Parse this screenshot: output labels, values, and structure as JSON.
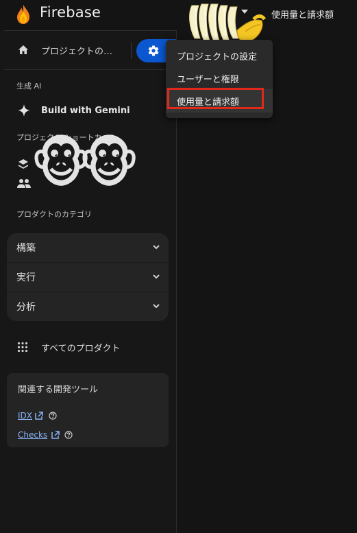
{
  "header": {
    "brand": "Firebase",
    "right_label": "使用量と請求額",
    "logo_icon": "firebase-flame-icon"
  },
  "sidebar": {
    "project_name": "プロジェクトの…",
    "genai_section": "生成 AI",
    "gemini_label": "Build with Gemini",
    "shortcuts_section": "プロジェクト ショートカット",
    "categories_section": "プロダクトのカテゴリ",
    "categories": [
      {
        "label": "構築"
      },
      {
        "label": "実行"
      },
      {
        "label": "分析"
      }
    ],
    "all_products": "すべてのプロダクト",
    "tools": {
      "title": "関連する開発ツール",
      "links": [
        {
          "label": "IDX"
        },
        {
          "label": "Checks"
        }
      ]
    }
  },
  "settings_menu": {
    "items": [
      {
        "label": "プロジェクトの設定"
      },
      {
        "label": "ユーザーと権限"
      },
      {
        "label": "使用量と請求額"
      }
    ],
    "highlighted_index": 2,
    "highlight_color": "#e0291b"
  },
  "colors": {
    "background": "#141414",
    "sidebar": "#171717",
    "accent_button": "#0b57d0",
    "link": "#8ab4f8"
  }
}
